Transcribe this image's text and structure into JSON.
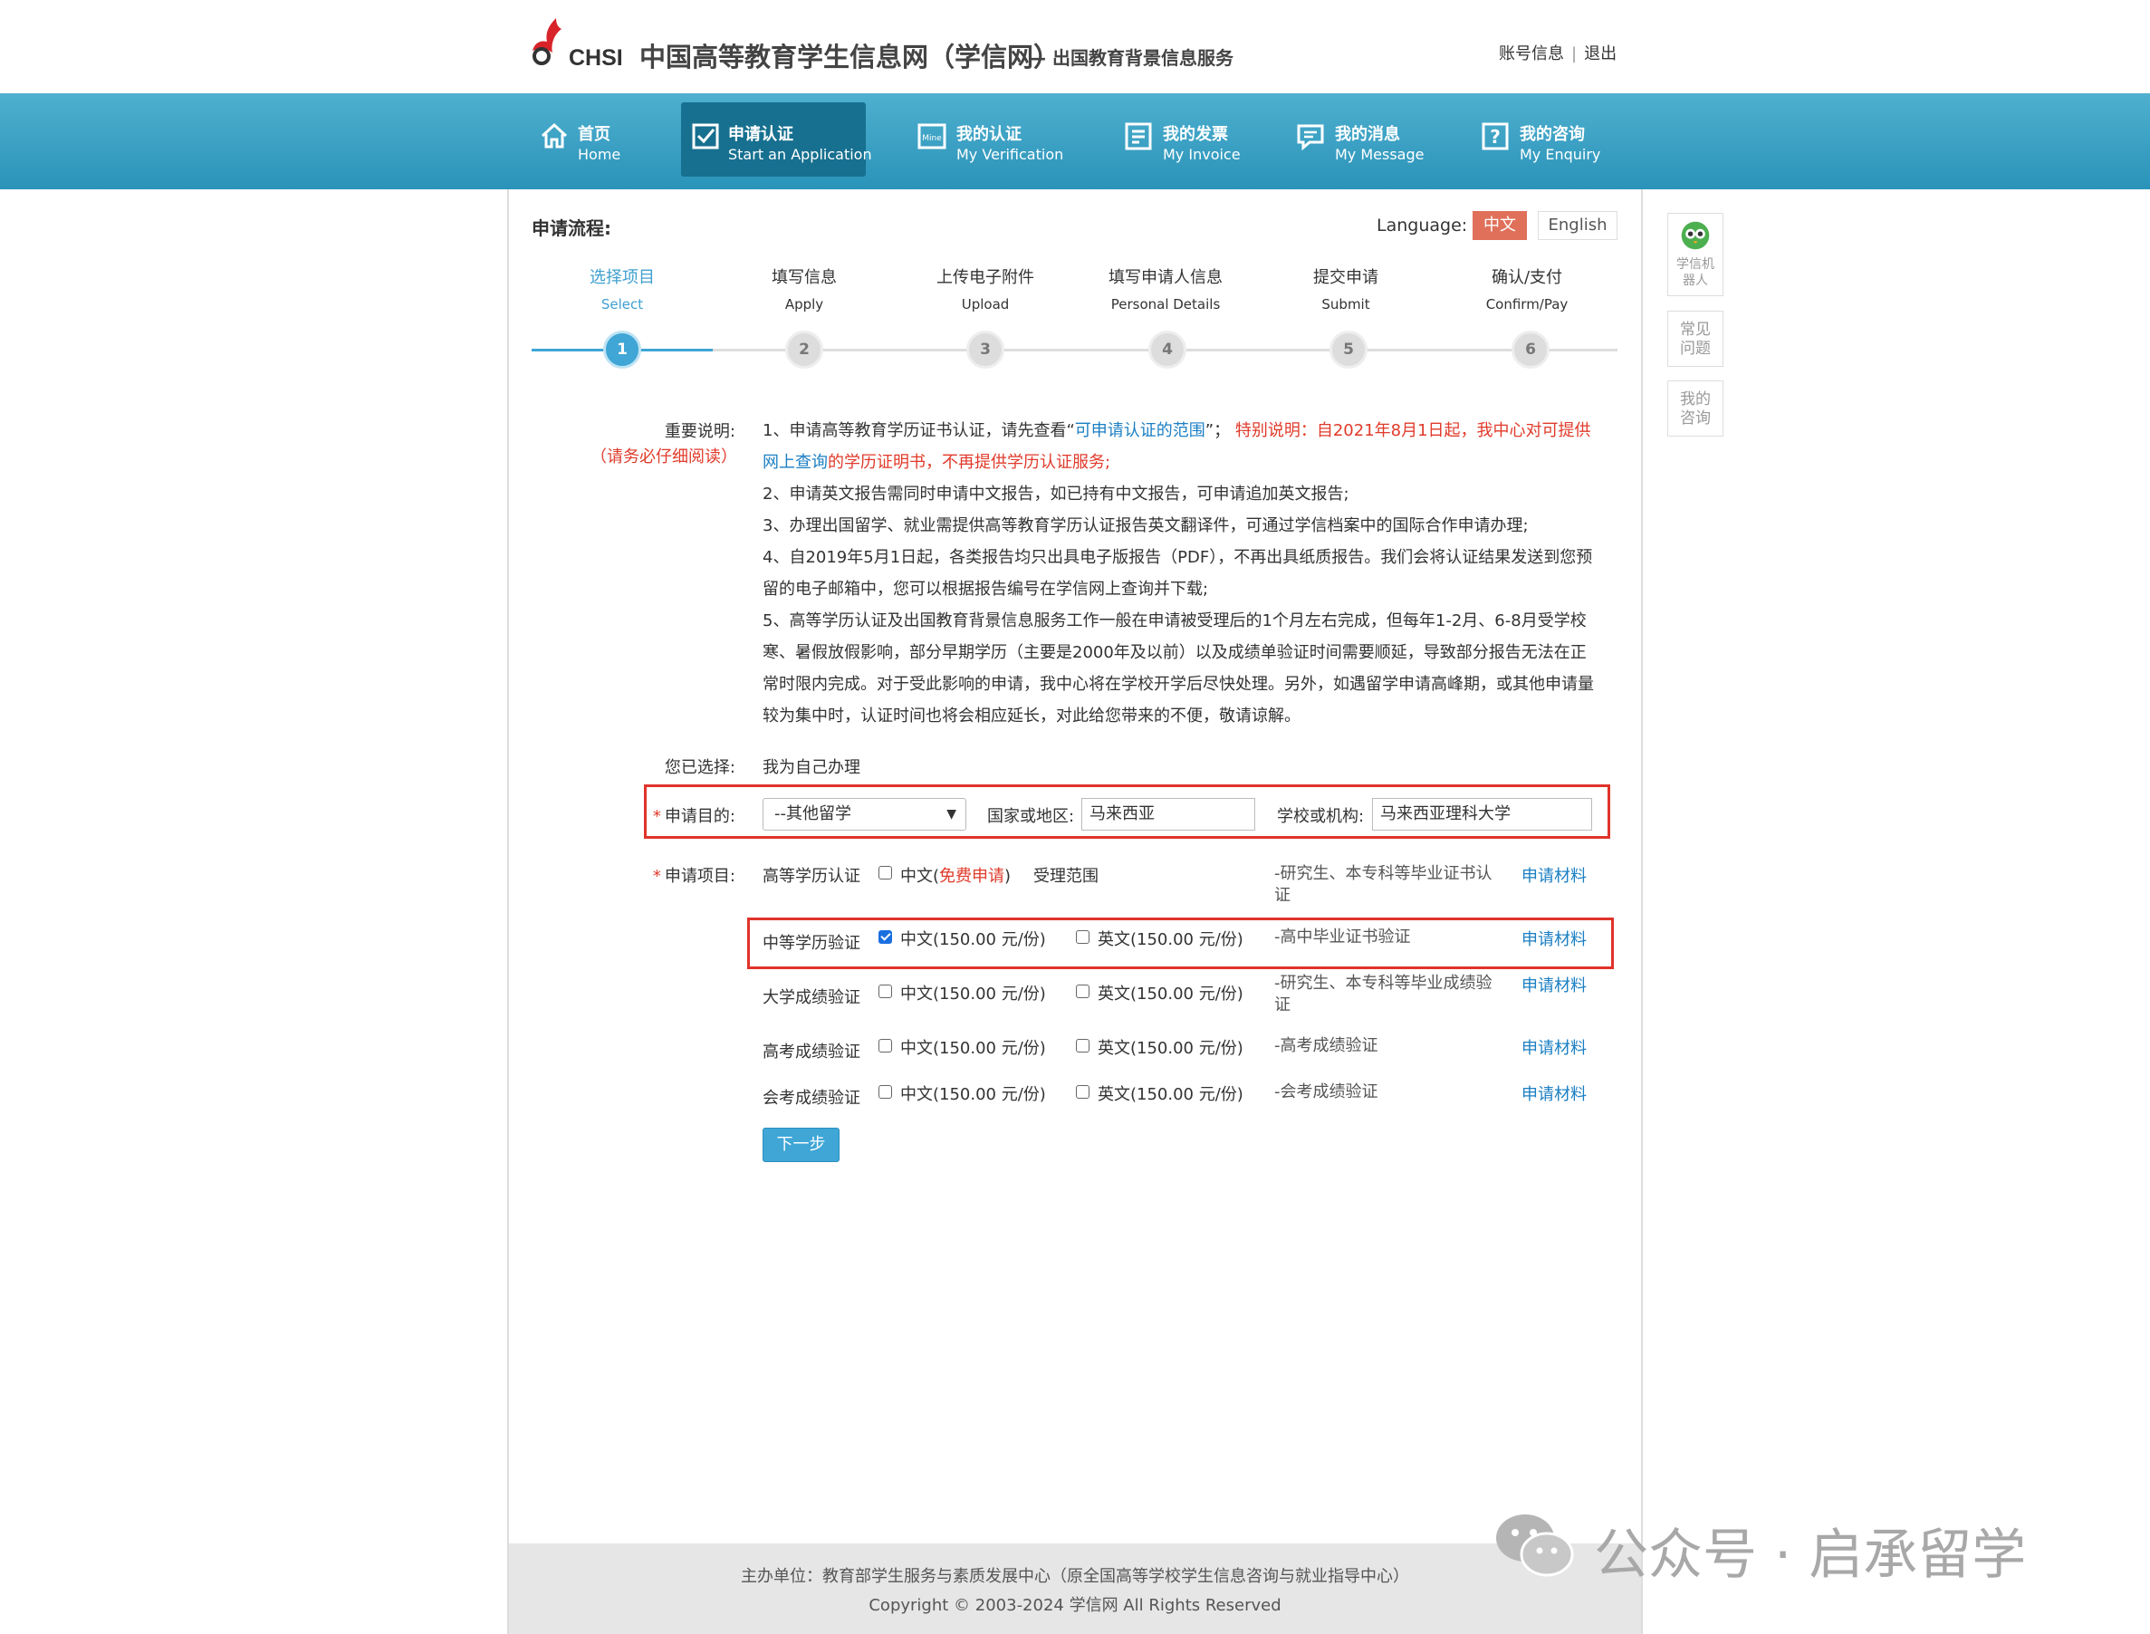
{
  "header": {
    "logo_text": "CHSI",
    "site_title": "中国高等教育学生信息网（学信网）",
    "site_subtitle": "— 出国教育背景信息服务",
    "account_info": "账号信息",
    "logout": "退出"
  },
  "nav": {
    "items": [
      {
        "cn": "首页",
        "en": "Home",
        "icon": "home-icon"
      },
      {
        "cn": "申请认证",
        "en": "Start an Application",
        "icon": "checkbox-icon",
        "active": true
      },
      {
        "cn": "我的认证",
        "en": "My Verification",
        "icon": "mine-icon"
      },
      {
        "cn": "我的发票",
        "en": "My Invoice",
        "icon": "invoice-icon"
      },
      {
        "cn": "我的消息",
        "en": "My Message",
        "icon": "message-icon"
      },
      {
        "cn": "我的咨询",
        "en": "My Enquiry",
        "icon": "enquiry-icon"
      }
    ]
  },
  "process": {
    "title": "申请流程:",
    "language_label": "Language:",
    "lang_cn": "中文",
    "lang_en": "English",
    "steps": [
      {
        "cn": "选择项目",
        "en": "Select",
        "num": "1",
        "active": true
      },
      {
        "cn": "填写信息",
        "en": "Apply",
        "num": "2"
      },
      {
        "cn": "上传电子附件",
        "en": "Upload",
        "num": "3"
      },
      {
        "cn": "填写申请人信息",
        "en": "Personal Details",
        "num": "4"
      },
      {
        "cn": "提交申请",
        "en": "Submit",
        "num": "5"
      },
      {
        "cn": "确认/支付",
        "en": "Confirm/Pay",
        "num": "6"
      }
    ]
  },
  "notice": {
    "label": "重要说明:",
    "label_sub": "（请务必仔细阅读）",
    "l1_a": "1、申请高等教育学历证书认证，请先查看“",
    "l1_link": "可申请认证的范围",
    "l1_b": "”；",
    "l1_red1": "特别说明：自2021年8月1日起，我中心对可提供",
    "l1_link2": "网上查询",
    "l1_red2": "的学历证明书，不再提供学历认证服务;",
    "l2": "2、申请英文报告需同时申请中文报告，如已持有中文报告，可申请追加英文报告;",
    "l3": "3、办理出国留学、就业需提供高等教育学历认证报告英文翻译件，可通过学信档案中的国际合作申请办理;",
    "l4": "4、自2019年5月1日起，各类报告均只出具电子版报告（PDF），不再出具纸质报告。我们会将认证结果发送到您预留的电子邮箱中，您可以根据报告编号在学信网上查询并下载;",
    "l5": "5、高等学历认证及出国教育背景信息服务工作一般在申请被受理后的1个月左右完成，但每年1-2月、6-8月受学校寒、暑假放假影响，部分早期学历（主要是2000年及以前）以及成绩单验证时间需要顺延，导致部分报告无法在正常时限内完成。对于受此影响的申请，我中心将在学校开学后尽快处理。另外，如遇留学申请高峰期，或其他申请量较为集中时，认证时间也将会相应延长，对此给您带来的不便，敬请谅解。"
  },
  "selected": {
    "label": "您已选择:",
    "value": "我为自己办理"
  },
  "purpose": {
    "label": "申请目的:",
    "select_value": "--其他留学",
    "country_label": "国家或地区:",
    "country_value": "马来西亚",
    "school_label": "学校或机构:",
    "school_value": "马来西亚理科大学"
  },
  "items": {
    "label": "申请项目:",
    "rows": [
      {
        "name": "高等学历认证",
        "cn": "中文(",
        "cn_free": "免费申请",
        "cn_end": ")",
        "scope": "受理范围",
        "desc": "-研究生、本专科等毕业证书认证",
        "material": "申请材料"
      },
      {
        "name": "中等学历验证",
        "cn": "中文(150.00 元/份)",
        "en": "英文(150.00 元/份)",
        "desc": "-高中毕业证书验证",
        "material": "申请材料",
        "cn_checked": true
      },
      {
        "name": "大学成绩验证",
        "cn": "中文(150.00 元/份)",
        "en": "英文(150.00 元/份)",
        "desc": "-研究生、本专科等毕业成绩验证",
        "material": "申请材料"
      },
      {
        "name": "高考成绩验证",
        "cn": "中文(150.00 元/份)",
        "en": "英文(150.00 元/份)",
        "desc": "-高考成绩验证",
        "material": "申请材料"
      },
      {
        "name": "会考成绩验证",
        "cn": "中文(150.00 元/份)",
        "en": "英文(150.00 元/份)",
        "desc": "-会考成绩验证",
        "material": "申请材料"
      }
    ]
  },
  "next_button": "下一步",
  "footer": {
    "line1": "主办单位：教育部学生服务与素质发展中心（原全国高等学校学生信息咨询与就业指导中心）",
    "line2": "Copyright © 2003-2024 学信网 All Rights Reserved"
  },
  "side": {
    "robot": "学信机器人",
    "faq": "常见问题",
    "mine": "我的咨询"
  },
  "watermark": "公众号 · 启承留学",
  "colors": {
    "nav_bg": "#2a93b9",
    "nav_active": "#17708f",
    "accent_blue": "#3fa6d6",
    "link_blue": "#1b7fc3",
    "red": "#e03a2a",
    "highlight_box": "#e0332a"
  }
}
